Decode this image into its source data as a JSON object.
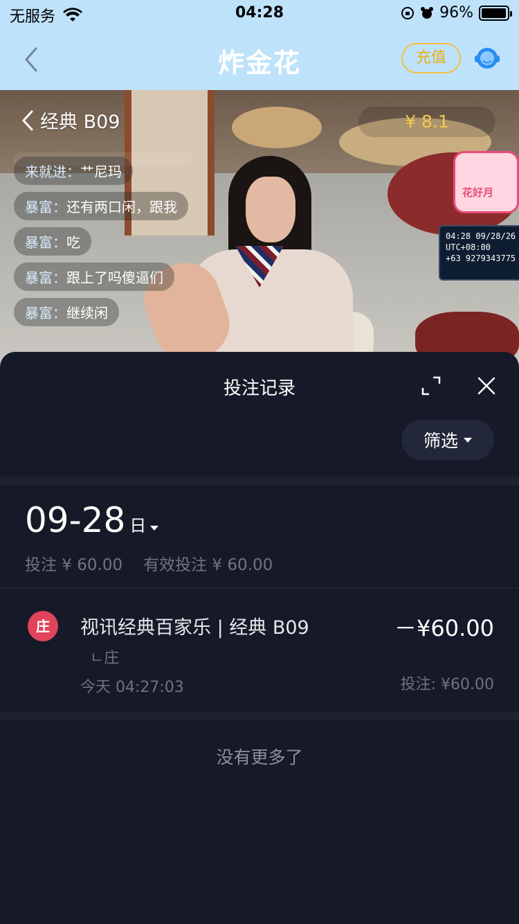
{
  "status_bar": {
    "carrier": "无服务",
    "time": "04:28",
    "battery": "96%",
    "battery_level": 0.96
  },
  "nav": {
    "title": "炸金花",
    "recharge_label": "充值",
    "icons": [
      "back-icon",
      "customer-service-icon"
    ]
  },
  "live": {
    "room_name": "经典 B09",
    "balance": "¥ 8.1",
    "overlay_sign": "花好月",
    "overlay_clock": [
      "04:28  09/28/26",
      "UTC+08:00",
      "+63 9279343775"
    ],
    "chat": [
      {
        "nick": "来就进",
        "sep": "：",
        "text": "艹尼玛"
      },
      {
        "nick": "暴富",
        "sep": "：",
        "text": "还有两口闲，跟我"
      },
      {
        "nick": "暴富",
        "sep": "：",
        "text": "吃"
      },
      {
        "nick": "暴富",
        "sep": "：",
        "text": "跟上了吗傻逼们"
      },
      {
        "nick": "暴富",
        "sep": "：",
        "text": "继续闲"
      }
    ]
  },
  "sheet": {
    "title": "投注记录",
    "filter_label": "筛选",
    "date": "09-28",
    "date_unit": "日",
    "summary_bet": "投注 ¥ 60.00",
    "summary_valid": "有效投注 ¥ 60.00",
    "records": [
      {
        "badge": "庄",
        "game": "视讯经典百家乐 | 经典 B09",
        "sub": "ㄴ庄",
        "time": "今天 04:27:03",
        "amount": "－¥60.00",
        "stake": "投注: ¥60.00"
      }
    ],
    "no_more": "没有更多了"
  },
  "colors": {
    "nav_bg": "#bfe2fb",
    "sheet_bg": "#161a28",
    "accent_gold": "#f3c13a",
    "badge_red": "#e0445b"
  }
}
